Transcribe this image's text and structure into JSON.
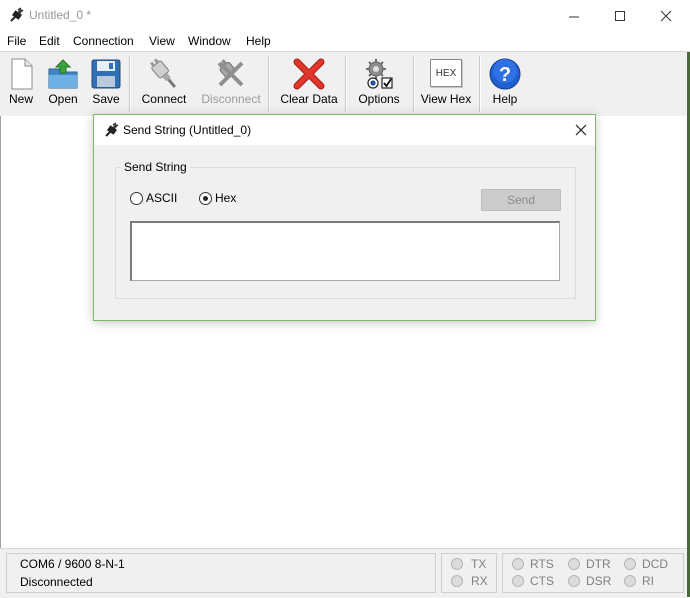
{
  "window": {
    "title": "Untitled_0 *"
  },
  "menu": [
    {
      "label": "File"
    },
    {
      "label": "Edit"
    },
    {
      "label": "Connection"
    },
    {
      "label": "View"
    },
    {
      "label": "Window"
    },
    {
      "label": "Help"
    }
  ],
  "toolbar": {
    "new": "New",
    "open": "Open",
    "save": "Save",
    "connect": "Connect",
    "disconnect": "Disconnect",
    "clear_data": "Clear Data",
    "options": "Options",
    "view_hex": "View Hex",
    "view_hex_icon_text": "HEX",
    "help": "Help"
  },
  "dialog": {
    "title": "Send String (Untitled_0)",
    "group_label": "Send String",
    "radio_ascii": "ASCII",
    "radio_hex": "Hex",
    "selected_mode": "Hex",
    "send_button": "Send",
    "input_value": ""
  },
  "status": {
    "port_settings": "COM6 / 9600 8-N-1",
    "connection_state": "Disconnected",
    "tx": "TX",
    "rx": "RX",
    "rts": "RTS",
    "cts": "CTS",
    "dtr": "DTR",
    "dsr": "DSR",
    "dcd": "DCD",
    "ri": "RI"
  },
  "colors": {
    "dialog_border": "#7db86b",
    "help_icon": "#1f5fd1",
    "clear_icon": "#d6281c"
  }
}
